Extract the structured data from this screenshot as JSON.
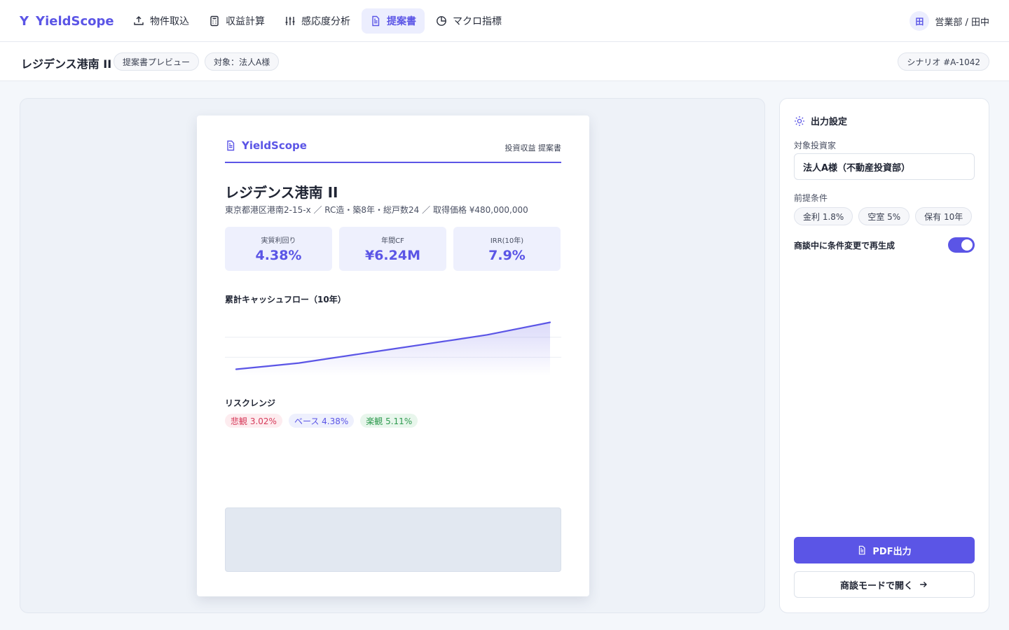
{
  "app": {
    "name": "YieldScope",
    "logo": "Y"
  },
  "nav": {
    "tabs": [
      {
        "label": "物件取込",
        "icon": "upload-icon"
      },
      {
        "label": "収益計算",
        "icon": "calculator-icon"
      },
      {
        "label": "感応度分析",
        "icon": "sliders-icon"
      },
      {
        "label": "提案書",
        "icon": "document-icon",
        "active": true
      },
      {
        "label": "マクロ指標",
        "icon": "pie-chart-icon"
      }
    ]
  },
  "user": {
    "avatar": "田",
    "label": "営業部 / 田中"
  },
  "subheader": {
    "title": "レジデンス港南 II",
    "pill_preview": "提案書プレビュー",
    "pill_target": "対象：法人A様",
    "scenario": "シナリオ #A-1042"
  },
  "paper": {
    "brand": "YieldScope",
    "doc_label": "投資収益 提案書",
    "property_name": "レジデンス港南 II",
    "address": "東京都港区港南2-15-x ／ RC造・築8年・総戸数24 ／ 取得価格 ¥480,000,000",
    "kpis": [
      {
        "label": "実質利回り",
        "value": "4.38%"
      },
      {
        "label": "年間CF",
        "value": "¥6.24M"
      },
      {
        "label": "IRR(10年)",
        "value": "7.9%"
      }
    ],
    "chart_title": "累計キャッシュフロー（10年）",
    "risk_title": "リスクレンジ",
    "risk": {
      "pessimistic": "悲観 3.02%",
      "base": "ベース 4.38%",
      "optimistic": "楽観 5.11%"
    }
  },
  "chart_data": {
    "type": "area",
    "x": [
      0,
      1,
      2,
      3,
      4,
      5,
      6,
      7,
      8,
      9,
      10
    ],
    "values": [
      0,
      0.6,
      1.2,
      2.1,
      3.0,
      3.9,
      4.8,
      5.7,
      6.6,
      7.8,
      9.0
    ],
    "title": "",
    "xlabel": "",
    "ylabel": "",
    "ylim": [
      -1,
      10
    ],
    "grid": true,
    "color": "#5b55e6"
  },
  "panel": {
    "title": "出力設定",
    "investor_label": "対象投資家",
    "investor_value": "法人A様（不動産投資部）",
    "conditions_label": "前提条件",
    "conditions": [
      "金利 1.8%",
      "空室 5%",
      "保有 10年"
    ],
    "regen_label": "商談中に条件変更で再生成",
    "regen_on": true,
    "pdf_button": "PDF出力",
    "meeting_button": "商談モードで開く"
  },
  "colors": {
    "accent": "#5b55e6",
    "negative": "#d63a5a",
    "positive": "#2e9a4f"
  }
}
